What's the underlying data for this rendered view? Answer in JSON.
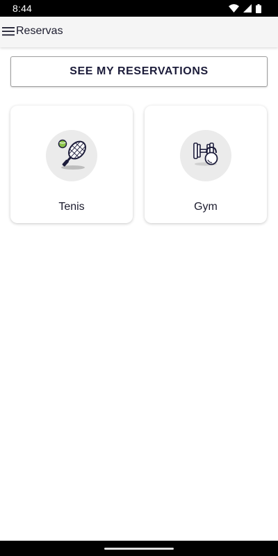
{
  "status_bar": {
    "time": "8:44",
    "icons": [
      "wifi-icon",
      "cell-signal-icon",
      "battery-icon"
    ]
  },
  "app_bar": {
    "menu_icon": "hamburger-menu-icon",
    "title": "Reservas"
  },
  "main": {
    "reservations_button_label": "SEE MY RESERVATIONS",
    "cards": [
      {
        "label": "Tenis",
        "icon": "tennis-racket-icon"
      },
      {
        "label": "Gym",
        "icon": "dumbbell-kettlebell-icon"
      }
    ]
  },
  "colors": {
    "status_bar_bg": "#000000",
    "app_bar_bg": "#f5f5f5",
    "icon_circle_bg": "#ebebeb",
    "text_primary": "#1c1c2e",
    "tennis_ball": "#8bc34a"
  }
}
